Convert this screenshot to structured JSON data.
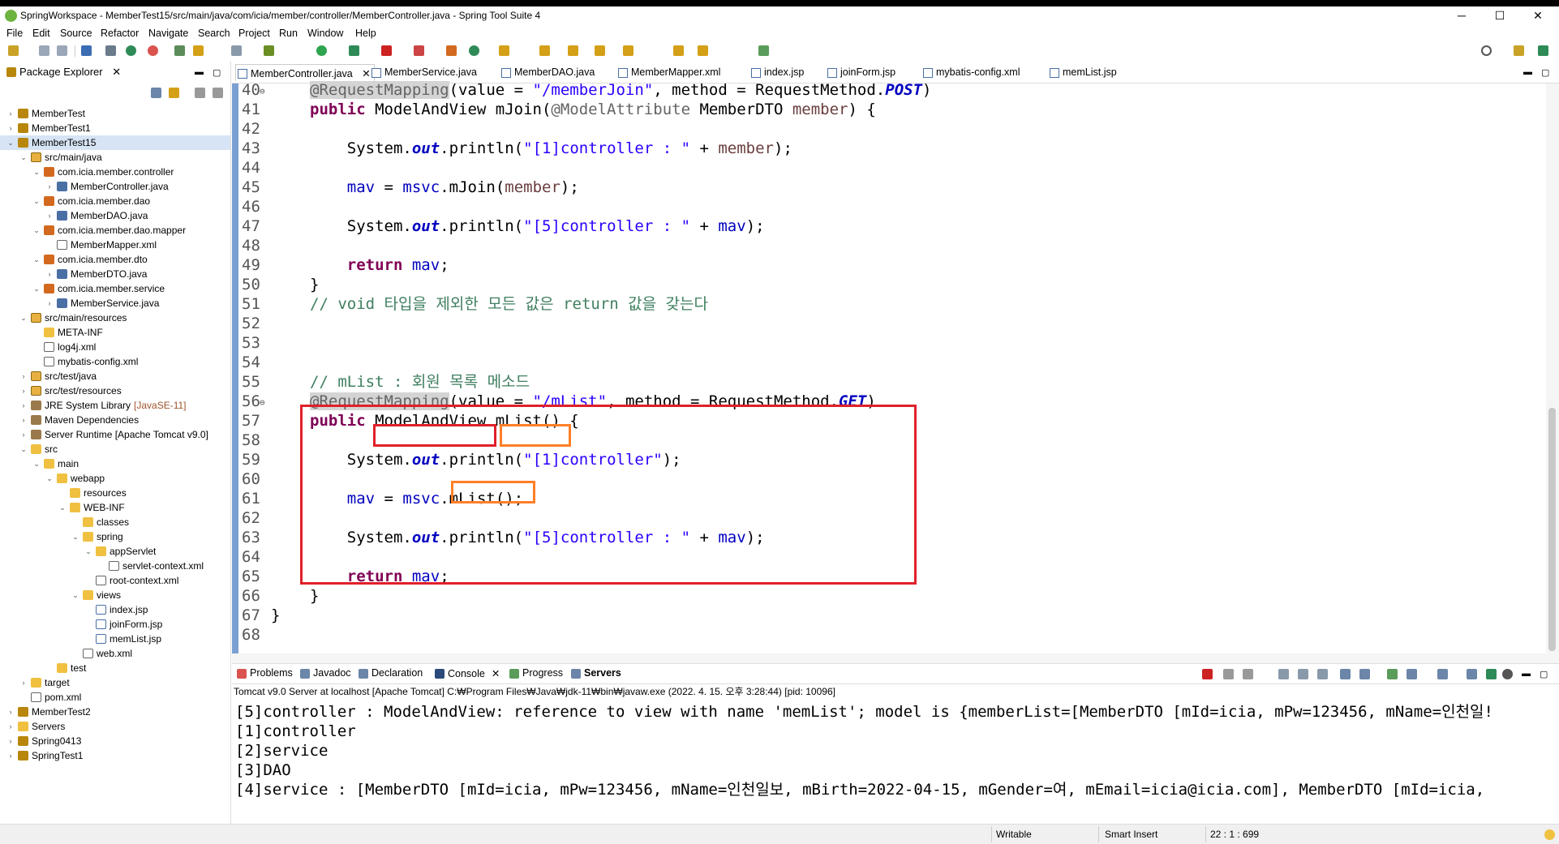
{
  "window": {
    "title": "SpringWorkspace - MemberTest15/src/main/java/com/icia/member/controller/MemberController.java - Spring Tool Suite 4",
    "minimize": "─",
    "maximize": "☐",
    "close": "✕"
  },
  "menu": [
    "File",
    "Edit",
    "Source",
    "Refactor",
    "Navigate",
    "Search",
    "Project",
    "Run",
    "Window",
    "Help"
  ],
  "package_explorer": {
    "tab_label": "Package Explorer",
    "close": "✕",
    "tree": [
      {
        "label": "MemberTest",
        "twisty": "›",
        "icon": "ic-proj"
      },
      {
        "label": "MemberTest1",
        "twisty": "›",
        "icon": "ic-proj"
      },
      {
        "label": "MemberTest15",
        "twisty": "⌄",
        "icon": "ic-proj"
      },
      {
        "label": "src/main/java",
        "twisty": "⌄",
        "icon": "ic-src"
      },
      {
        "label": "com.icia.member.controller",
        "twisty": "⌄",
        "icon": "ic-pkg"
      },
      {
        "label": "MemberController.java",
        "twisty": "›",
        "icon": "ic-java"
      },
      {
        "label": "com.icia.member.dao",
        "twisty": "⌄",
        "icon": "ic-pkg"
      },
      {
        "label": "MemberDAO.java",
        "twisty": "›",
        "icon": "ic-java"
      },
      {
        "label": "com.icia.member.dao.mapper",
        "twisty": "⌄",
        "icon": "ic-pkg"
      },
      {
        "label": "MemberMapper.xml",
        "twisty": "",
        "icon": "ic-xml"
      },
      {
        "label": "com.icia.member.dto",
        "twisty": "⌄",
        "icon": "ic-pkg"
      },
      {
        "label": "MemberDTO.java",
        "twisty": "›",
        "icon": "ic-java"
      },
      {
        "label": "com.icia.member.service",
        "twisty": "⌄",
        "icon": "ic-pkg"
      },
      {
        "label": "MemberService.java",
        "twisty": "›",
        "icon": "ic-java"
      },
      {
        "label": "src/main/resources",
        "twisty": "⌄",
        "icon": "ic-src"
      },
      {
        "label": "META-INF",
        "twisty": "",
        "icon": "ic-folder"
      },
      {
        "label": "log4j.xml",
        "twisty": "",
        "icon": "ic-xml"
      },
      {
        "label": "mybatis-config.xml",
        "twisty": "",
        "icon": "ic-xml"
      },
      {
        "label": "src/test/java",
        "twisty": "›",
        "icon": "ic-src"
      },
      {
        "label": "src/test/resources",
        "twisty": "›",
        "icon": "ic-src"
      },
      {
        "label": "JRE System Library",
        "suffix": "[JavaSE-11]",
        "twisty": "›",
        "icon": "ic-lib"
      },
      {
        "label": "Maven Dependencies",
        "twisty": "›",
        "icon": "ic-lib"
      },
      {
        "label": "Server Runtime [Apache Tomcat v9.0]",
        "twisty": "›",
        "icon": "ic-lib"
      },
      {
        "label": "src",
        "twisty": "⌄",
        "icon": "ic-folder"
      },
      {
        "label": "main",
        "twisty": "⌄",
        "icon": "ic-folder"
      },
      {
        "label": "webapp",
        "twisty": "⌄",
        "icon": "ic-folder"
      },
      {
        "label": "resources",
        "twisty": "",
        "icon": "ic-folder"
      },
      {
        "label": "WEB-INF",
        "twisty": "⌄",
        "icon": "ic-folder"
      },
      {
        "label": "classes",
        "twisty": "",
        "icon": "ic-folder"
      },
      {
        "label": "spring",
        "twisty": "⌄",
        "icon": "ic-folder"
      },
      {
        "label": "appServlet",
        "twisty": "⌄",
        "icon": "ic-folder"
      },
      {
        "label": "servlet-context.xml",
        "twisty": "",
        "icon": "ic-xml"
      },
      {
        "label": "root-context.xml",
        "twisty": "",
        "icon": "ic-xml"
      },
      {
        "label": "views",
        "twisty": "⌄",
        "icon": "ic-folder"
      },
      {
        "label": "index.jsp",
        "twisty": "",
        "icon": "ic-jsp"
      },
      {
        "label": "joinForm.jsp",
        "twisty": "",
        "icon": "ic-jsp"
      },
      {
        "label": "memList.jsp",
        "twisty": "",
        "icon": "ic-jsp"
      },
      {
        "label": "web.xml",
        "twisty": "",
        "icon": "ic-xml"
      },
      {
        "label": "test",
        "twisty": "",
        "icon": "ic-folder"
      },
      {
        "label": "target",
        "twisty": "›",
        "icon": "ic-folder"
      },
      {
        "label": "pom.xml",
        "twisty": "",
        "icon": "ic-xml"
      },
      {
        "label": "MemberTest2",
        "twisty": "›",
        "icon": "ic-proj"
      },
      {
        "label": "Servers",
        "twisty": "›",
        "icon": "ic-folder"
      },
      {
        "label": "Spring0413",
        "twisty": "›",
        "icon": "ic-proj"
      },
      {
        "label": "SpringTest1",
        "twisty": "›",
        "icon": "ic-proj"
      }
    ]
  },
  "editor_tabs": [
    "MemberController.java",
    "MemberService.java",
    "MemberDAO.java",
    "MemberMapper.xml",
    "index.jsp",
    "joinForm.jsp",
    "mybatis-config.xml",
    "memList.jsp"
  ],
  "code": [
    {
      "n": "40",
      "fold": "⊖",
      "html": "<span class=\"ann\">@RequestMapping</span>(value = <span class=\"str\">\"/memberJoin\"</span>, method = RequestMethod.<span class=\"fld\">POST</span>)"
    },
    {
      "n": "41",
      "html": "<span class=\"kw\">public</span> ModelAndView mJoin(<span class=\"ann\" style=\"background:none\">@ModelAttribute</span> MemberDTO <span class=\"var\">member</span>) {"
    },
    {
      "n": "42",
      "html": ""
    },
    {
      "n": "43",
      "html": "    System.<span class=\"fld\">out</span>.println(<span class=\"str\">\"[1]controller : \"</span> + <span class=\"var\">member</span>);"
    },
    {
      "n": "44",
      "html": ""
    },
    {
      "n": "45",
      "html": "    <span class=\"str\" style=\"color:#0000c0\">mav</span> = <span class=\"str\" style=\"color:#0000c0\">msvc</span>.mJoin(<span class=\"var\">member</span>);"
    },
    {
      "n": "46",
      "html": ""
    },
    {
      "n": "47",
      "html": "    System.<span class=\"fld\">out</span>.println(<span class=\"str\">\"[5]controller : \"</span> + <span class=\"str\" style=\"color:#0000c0\">mav</span>);"
    },
    {
      "n": "48",
      "html": ""
    },
    {
      "n": "49",
      "html": "    <span class=\"kw\">return</span> <span class=\"str\" style=\"color:#0000c0\">mav</span>;"
    },
    {
      "n": "50",
      "html": "}"
    },
    {
      "n": "51",
      "html": "<span class=\"cm\">// void 타입을 제외한 모든 값은 return 값을 갖는다</span>"
    },
    {
      "n": "52",
      "html": ""
    },
    {
      "n": "53",
      "html": ""
    },
    {
      "n": "54",
      "html": ""
    },
    {
      "n": "55",
      "html": "<span class=\"cm\">// mList : 회원 목록 메소드</span>"
    },
    {
      "n": "56",
      "fold": "⊖",
      "html": "<span class=\"ann\">@RequestMapping</span>(value = <span class=\"str\">\"/mList\"</span>, method = RequestMethod.<span class=\"fld\">GET</span>)"
    },
    {
      "n": "57",
      "html": "<span class=\"kw\">public</span> ModelAndView mList() {"
    },
    {
      "n": "58",
      "html": ""
    },
    {
      "n": "59",
      "html": "    System.<span class=\"fld\">out</span>.println(<span class=\"str\">\"[1]controller\"</span>);"
    },
    {
      "n": "60",
      "html": ""
    },
    {
      "n": "61",
      "html": "    <span class=\"str\" style=\"color:#0000c0\">mav</span> = <span class=\"str\" style=\"color:#0000c0\">msvc</span>.mList();"
    },
    {
      "n": "62",
      "html": ""
    },
    {
      "n": "63",
      "html": "    System.<span class=\"fld\">out</span>.println(<span class=\"str\">\"[5]controller : \"</span> + <span class=\"str\" style=\"color:#0000c0\">mav</span>);"
    },
    {
      "n": "64",
      "html": ""
    },
    {
      "n": "65",
      "html": "    <span class=\"kw\">return</span> <span class=\"str\" style=\"color:#0000c0\">mav</span>;"
    },
    {
      "n": "66",
      "html": "}"
    },
    {
      "n": "67",
      "html": "}",
      "outdent": true
    },
    {
      "n": "68",
      "html": ""
    }
  ],
  "bottom_tabs": [
    "Problems",
    "Javadoc",
    "Declaration",
    "Console",
    "Progress",
    "Servers"
  ],
  "console": {
    "description": "Tomcat v9.0 Server at localhost [Apache Tomcat] C:₩Program Files₩Java₩jdk-11₩bin₩javaw.exe  (2022. 4. 15. 오후 3:28:44) [pid: 10096]",
    "lines": [
      "[5]controller : ModelAndView: reference to view with name 'memList'; model is {memberList=[MemberDTO [mId=icia, mPw=123456, mName=인천일!",
      "[1]controller",
      "[2]service",
      "[3]DAO",
      "[4]service : [MemberDTO [mId=icia, mPw=123456, mName=인천일보, mBirth=2022-04-15, mGender=여, mEmail=icia@icia.com], MemberDTO [mId=icia,"
    ]
  },
  "status": {
    "writable": "Writable",
    "insert_mode": "Smart Insert",
    "position": "22 : 1 : 699"
  },
  "colors": {
    "highlight_red": "#e0202a",
    "highlight_orange": "#ff7f27"
  }
}
